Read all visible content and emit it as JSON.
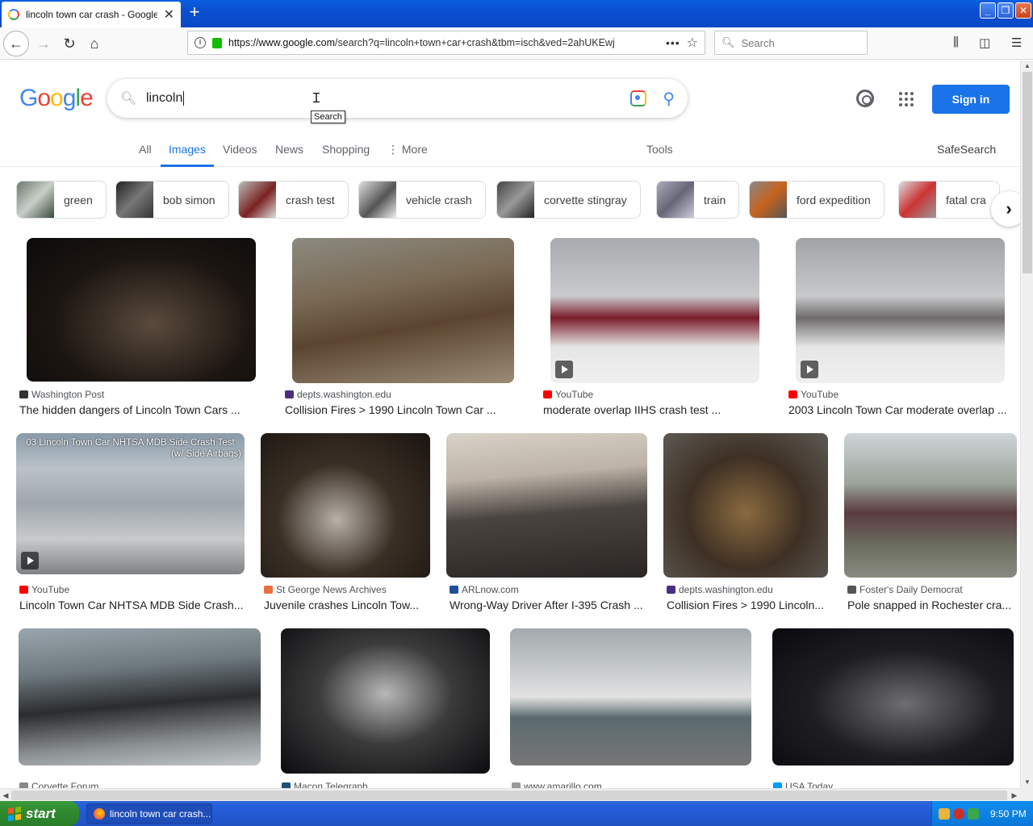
{
  "browser": {
    "tab_title": "lincoln town car crash - Google Search",
    "url_host": "https://www.google.com",
    "url_rest": "/search?q=lincoln+town+car+crash&tbm=isch&ved=2ahUKEwj",
    "search_placeholder": "Search"
  },
  "google": {
    "logo": [
      "G",
      "o",
      "o",
      "g",
      "l",
      "e"
    ],
    "query": "lincoln",
    "tooltip": "Search",
    "sign_in": "Sign in",
    "tabs": [
      "All",
      "Images",
      "Videos",
      "News",
      "Shopping",
      "More"
    ],
    "tools": "Tools",
    "safesearch": "SafeSearch",
    "chips": [
      "green",
      "bob simon",
      "crash test",
      "vehicle crash",
      "corvette stingray",
      "train",
      "ford expedition",
      "fatal cra"
    ]
  },
  "results": [
    {
      "source": "Washington Post",
      "title": "The hidden dangers of Lincoln Town Cars ...",
      "fav": "#333333"
    },
    {
      "source": "depts.washington.edu",
      "title": "Collision Fires > 1990 Lincoln Town Car ...",
      "fav": "#4b2e83"
    },
    {
      "source": "YouTube",
      "title": "moderate overlap IIHS crash test ...",
      "fav": "#ff0000"
    },
    {
      "source": "YouTube",
      "title": "2003 Lincoln Town Car moderate overlap ...",
      "fav": "#ff0000"
    },
    {
      "source": "YouTube",
      "title": "Lincoln Town Car NHTSA MDB Side Crash...",
      "fav": "#ff0000",
      "overlay": "03 Lincoln Town Car NHTSA MDB Side Crash Test",
      "overlay2": "(w/ Side Airbags)"
    },
    {
      "source": "St George News Archives",
      "title": "Juvenile crashes Lincoln Tow...",
      "fav": "#e8703a"
    },
    {
      "source": "ARLnow.com",
      "title": "Wrong-Way Driver After I-395 Crash ...",
      "fav": "#1f4e9b"
    },
    {
      "source": "depts.washington.edu",
      "title": "Collision Fires > 1990 Lincoln...",
      "fav": "#4b2e83"
    },
    {
      "source": "Foster's Daily Democrat",
      "title": "Pole snapped in Rochester cra...",
      "fav": "#555555"
    },
    {
      "source": "Corvette Forum",
      "title": "",
      "fav": "#888888"
    },
    {
      "source": "Macon Telegraph",
      "title": "",
      "fav": "#1f4e79"
    },
    {
      "source": "www.amarillo.com",
      "title": "",
      "fav": "#999999"
    },
    {
      "source": "USA Today",
      "title": "",
      "fav": "#009bff"
    }
  ],
  "taskbar": {
    "start": "start",
    "item": "lincoln town car crash...",
    "clock": "9:50 PM"
  },
  "colors": {
    "accent": "#1a73e8",
    "xp_blue": "#245edb",
    "start_green": "#2f8a2f"
  }
}
